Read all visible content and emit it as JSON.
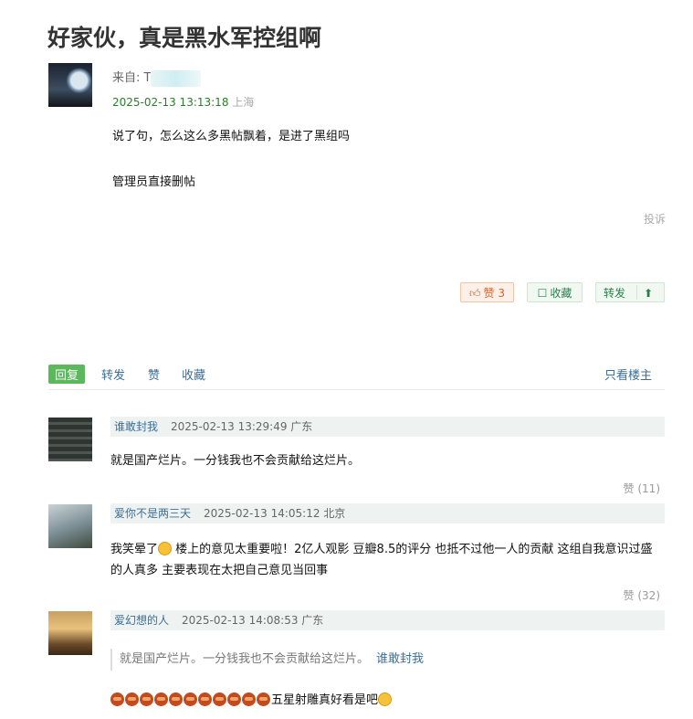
{
  "post": {
    "title": "好家伙，真是黑水军控组啊",
    "from_label": "来自: ",
    "author_partial": "T",
    "timestamp": "2025-02-13 13:13:18",
    "location": "上海",
    "paragraphs": [
      "说了句，怎么这么多黑帖飘着，是进了黑组吗",
      "管理员直接删帖"
    ],
    "report": "投诉",
    "like_label": "赞 3",
    "favorite_label": "收藏",
    "share_label": "转发"
  },
  "actionbar": {
    "reply": "回复",
    "forward": "转发",
    "like": "赞",
    "favorite": "收藏",
    "only_owner": "只看楼主"
  },
  "comments": [
    {
      "user": "谁敢封我",
      "time": "2025-02-13 13:29:49 广东",
      "text": "就是国产烂片。一分钱我也不会贡献给这烂片。",
      "likes": "赞 (11)"
    },
    {
      "user": "爱你不是两三天",
      "time": "2025-02-13 14:05:12 北京",
      "text_a": "我笑晕了",
      "text_b": " 楼上的意见太重要啦！2亿人观影 豆瓣8.5的评分 也抵不过他一人的贡献 这组自我意识过盛的人真多 主要表现在太把自己意见当回事",
      "likes": "赞 (32)"
    },
    {
      "user": "爱幻想的人",
      "time": "2025-02-13 14:08:53 广东",
      "quote": "就是国产烂片。一分钱我也不会贡献给这烂片。",
      "quote_user": "谁敢封我",
      "text": "五星射雕真好看是吧"
    }
  ]
}
